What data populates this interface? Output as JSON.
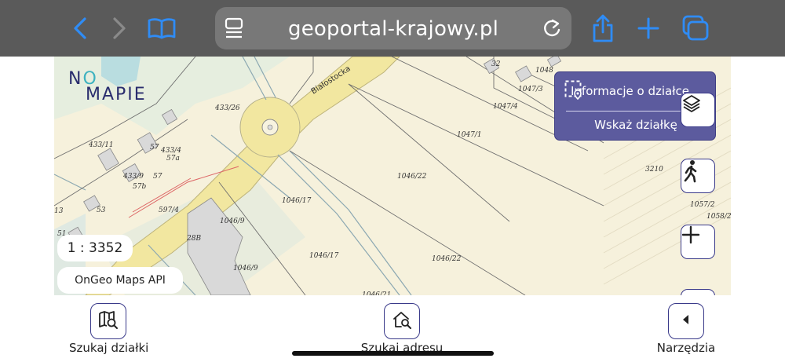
{
  "browser": {
    "url": "geoportal-krajowy.pl",
    "icons": [
      "back-chevron-icon",
      "forward-chevron-icon",
      "book-icon",
      "reader-icon",
      "reload-icon",
      "share-icon",
      "plus-icon",
      "tabs-icon"
    ]
  },
  "logo": {
    "line1_a": "N",
    "line1_o": "O",
    "line2": "MAPIE"
  },
  "map": {
    "road_name": "Białostocka",
    "plots": [
      "433/26",
      "433/11",
      "57",
      "433/4",
      "57a",
      "433/9",
      "57",
      "57b",
      "13",
      "53",
      "597/4",
      "51",
      "28B",
      "1046/9",
      "1046/17",
      "1046/17",
      "1046/9",
      "1046/22",
      "1046/22",
      "1047/1",
      "1047/4",
      "1047/3",
      "1048",
      "32",
      "3210",
      "1057/2",
      "1058/2",
      "1046/21"
    ],
    "scale": "1 : 3352",
    "attribution": "OnGeo Maps API"
  },
  "info_panel": {
    "row1_label": "Informacje o działce",
    "row2_label": "Wskaż działkę",
    "accent": "#5c5b9e"
  },
  "map_controls": [
    "layers-icon",
    "pedestrian-icon",
    "zoom-in-icon"
  ],
  "bottom_toolbar": {
    "items": [
      {
        "label": "Szukaj działki",
        "icon": "map-search-icon"
      },
      {
        "label": "Szukaj adresu",
        "icon": "home-search-icon"
      },
      {
        "label": "Narzędzia",
        "icon": "caret-left-icon"
      }
    ]
  }
}
